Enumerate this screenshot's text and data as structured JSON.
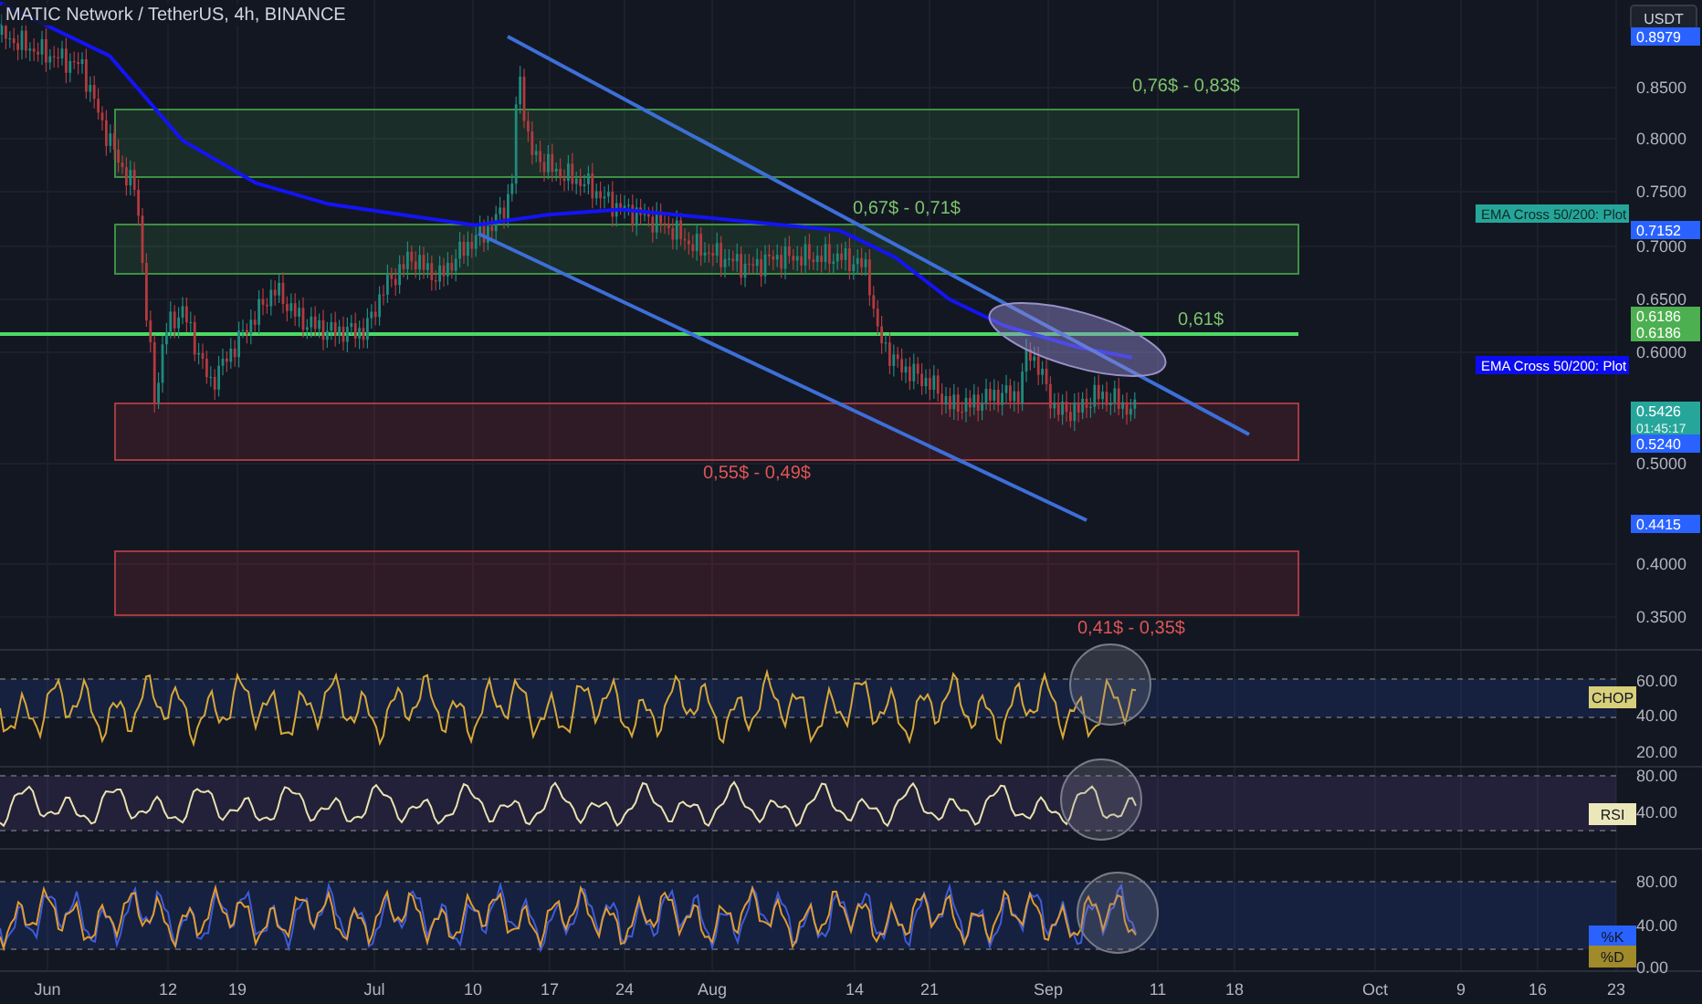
{
  "header": {
    "title": "MATIC Network / TetherUS, 4h, BINANCE"
  },
  "price_axis": {
    "currency": "USDT",
    "ticks": [
      "0.8500",
      "0.8000",
      "0.7500",
      "0.7000",
      "0.6500",
      "0.6000",
      "0.5000",
      "0.4000",
      "0.3500"
    ],
    "markers": [
      {
        "label": "0.8979",
        "color": "#2962ff"
      },
      {
        "label": "0.7152",
        "color": "#2962ff"
      },
      {
        "label": "0.6186",
        "color": "#4caf50"
      },
      {
        "label": "0.6186",
        "color": "#4caf50"
      },
      {
        "label": "0.5426",
        "sublabel": "01:45:17",
        "color": "#26a69a"
      },
      {
        "label": "0.5240",
        "color": "#2962ff"
      },
      {
        "label": "0.4415",
        "color": "#2962ff"
      }
    ]
  },
  "plot_labels": [
    {
      "label": "EMA Cross 50/200: Plot",
      "color": "#26a69a"
    },
    {
      "label": "EMA Cross 50/200: Plot",
      "color": "#0c0cf0"
    }
  ],
  "zones": [
    {
      "label": "0,76$ - 0,83$",
      "kind": "resistance"
    },
    {
      "label": "0,67$ - 0,71$",
      "kind": "resistance"
    },
    {
      "label": "0,61$",
      "kind": "level"
    },
    {
      "label": "0,55$ - 0,49$",
      "kind": "support"
    },
    {
      "label": "0,41$ - 0,35$",
      "kind": "support"
    }
  ],
  "indicators": [
    {
      "ticks": [
        "60.00",
        "40.00",
        "20.00"
      ],
      "labels": [
        {
          "text": "CHOP",
          "color": "#d8cf7a"
        }
      ]
    },
    {
      "ticks": [
        "80.00",
        "40.00"
      ],
      "labels": [
        {
          "text": "RSI",
          "color": "#ebe7b8"
        }
      ]
    },
    {
      "ticks": [
        "80.00",
        "40.00",
        "0.00"
      ],
      "labels": [
        {
          "text": "%K",
          "color": "#2962ff"
        },
        {
          "text": "%D",
          "color": "#a08a2a"
        }
      ]
    }
  ],
  "time_axis": [
    "Jun",
    "12",
    "19",
    "Jul",
    "10",
    "17",
    "24",
    "Aug",
    "14",
    "21",
    "Sep",
    "11",
    "18",
    "Oct",
    "9",
    "16",
    "23"
  ]
}
